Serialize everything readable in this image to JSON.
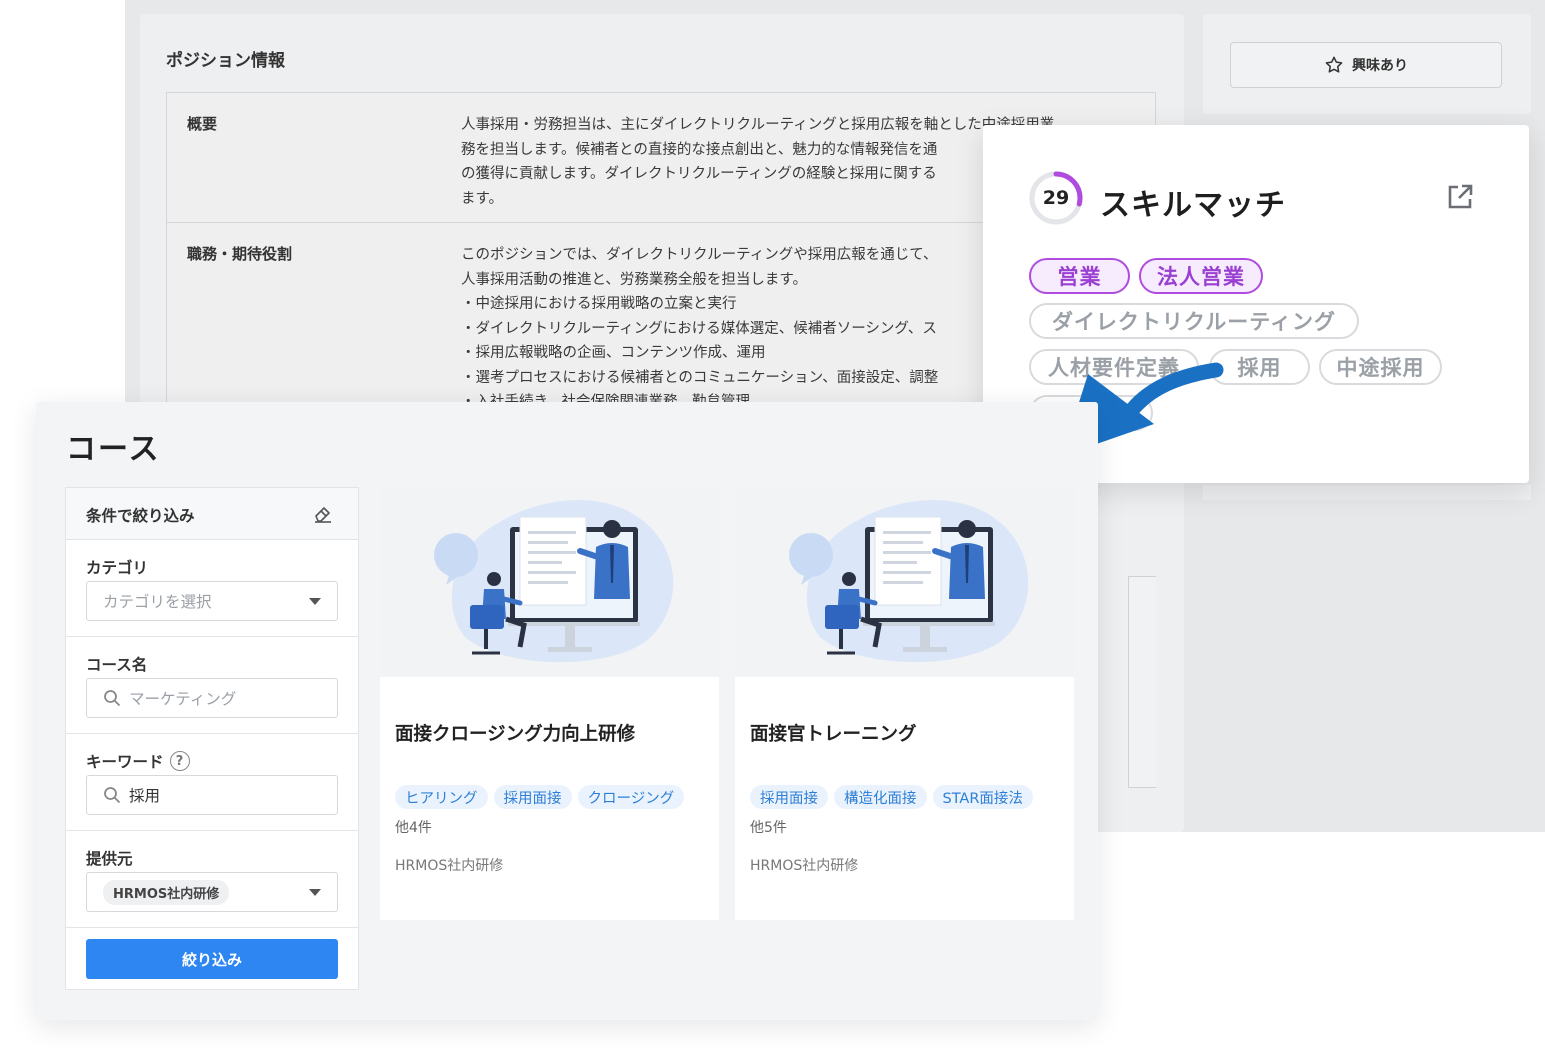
{
  "position": {
    "section_title": "ポジション情報",
    "rows": [
      {
        "label": "概要",
        "text": "人事採用・労務担当は、主にダイレクトリクルーティングと採用広報を軸とした中途採用業\n務を担当します。候補者との直接的な接点創出と、魅力的な情報発信を通\nの獲得に貢献します。ダイレクトリクルーティングの経験と採用に関する\nます。"
      },
      {
        "label": "職務・期待役割",
        "text": "このポジションでは、ダイレクトリクルーティングや採用広報を通じて、\n人事採用活動の推進と、労務業務全般を担当します。\n・中途採用における採用戦略の立案と実行\n・ダイレクトリクルーティングにおける媒体選定、候補者ソーシング、ス\n・採用広報戦略の企画、コンテンツ作成、運用\n・選考プロセスにおける候補者とのコミュニケーション、面接設定、調整\n・入社手続き、社会保険関連業務、勤怠管理"
      }
    ],
    "interest_button": "興味あり"
  },
  "skill_match": {
    "score": "29",
    "score_fraction": 0.29,
    "title": "スキルマッチ",
    "tags": [
      {
        "label": "営業",
        "matched": true
      },
      {
        "label": "法人営業",
        "matched": true
      },
      {
        "label": "ダイレクトリクルーティング",
        "matched": false
      },
      {
        "label": "人材要件定義",
        "matched": false
      },
      {
        "label": "採用",
        "matched": false
      },
      {
        "label": "中途採用",
        "matched": false
      },
      {
        "label": "",
        "matched": false
      }
    ],
    "accent_color": "#b04be0"
  },
  "course": {
    "title": "コース",
    "filter": {
      "header": "条件で絞り込み",
      "category_label": "カテゴリ",
      "category_placeholder": "カテゴリを選択",
      "course_name_label": "コース名",
      "course_name_placeholder": "マーケティング",
      "keyword_label": "キーワード",
      "keyword_help": "?",
      "keyword_value": "採用",
      "provider_label": "提供元",
      "provider_value": "HRMOS社内研修",
      "apply_button": "絞り込み",
      "accent_color": "#2d86f2"
    },
    "cards": [
      {
        "title": "面接クロージング力向上研修",
        "tags": [
          "ヒアリング",
          "採用面接",
          "クロージング"
        ],
        "more": "他4件",
        "provider": "HRMOS社内研修"
      },
      {
        "title": "面接官トレーニング",
        "tags": [
          "採用面接",
          "構造化面接",
          "STAR面接法"
        ],
        "more": "他5件",
        "provider": "HRMOS社内研修"
      }
    ]
  }
}
